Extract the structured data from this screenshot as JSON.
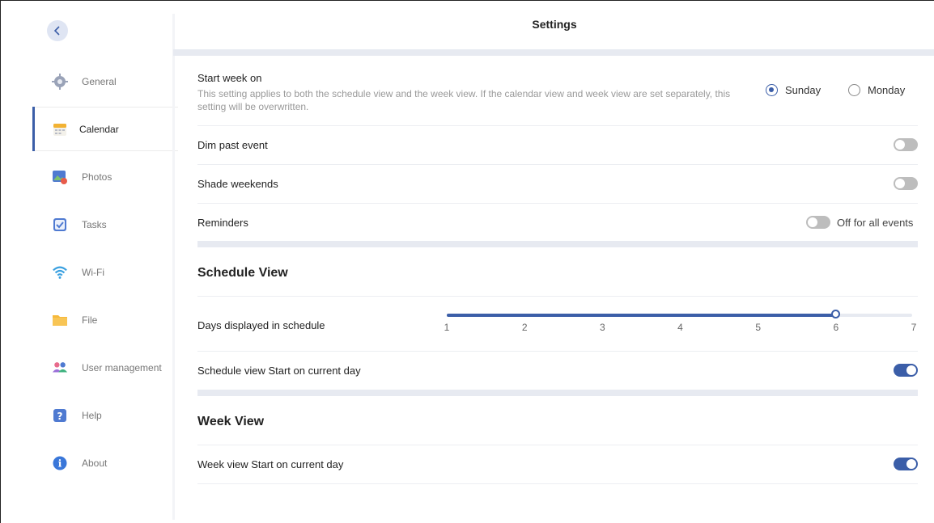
{
  "header": {
    "title": "Settings"
  },
  "sidebar": {
    "items": [
      {
        "label": "General",
        "icon": "gear-icon",
        "active": false
      },
      {
        "label": "Calendar",
        "icon": "calendar-icon",
        "active": true
      },
      {
        "label": "Photos",
        "icon": "photos-icon",
        "active": false
      },
      {
        "label": "Tasks",
        "icon": "checkbox-icon",
        "active": false
      },
      {
        "label": "Wi-Fi",
        "icon": "wifi-icon",
        "active": false
      },
      {
        "label": "File",
        "icon": "folder-icon",
        "active": false
      },
      {
        "label": "User management",
        "icon": "users-icon",
        "active": false
      },
      {
        "label": "Help",
        "icon": "help-icon",
        "active": false
      },
      {
        "label": "About",
        "icon": "info-icon",
        "active": false
      }
    ]
  },
  "settings": {
    "start_week": {
      "label": "Start week on",
      "description": "This setting applies to both the schedule view and the week view. If the calendar view and week view are set separately, this setting will be overwritten.",
      "options": [
        "Sunday",
        "Monday"
      ],
      "selected": "Sunday"
    },
    "dim_past": {
      "label": "Dim past event",
      "enabled": false
    },
    "shade_weekends": {
      "label": "Shade weekends",
      "enabled": false
    },
    "reminders": {
      "label": "Reminders",
      "enabled": false,
      "status": "Off for all events"
    }
  },
  "schedule_view": {
    "title": "Schedule View",
    "days": {
      "label": "Days displayed in schedule",
      "ticks": [
        "1",
        "2",
        "3",
        "4",
        "5",
        "6",
        "7"
      ],
      "min": 1,
      "max": 7,
      "value": 6
    },
    "start_current": {
      "label": "Schedule view Start on current day",
      "enabled": true
    }
  },
  "week_view": {
    "title": "Week View",
    "start_current": {
      "label": "Week view Start on current day",
      "enabled": true
    }
  },
  "colors": {
    "accent": "#3b5ea8",
    "toggle_off": "#bdbdbd",
    "band": "#e7eaf1"
  }
}
